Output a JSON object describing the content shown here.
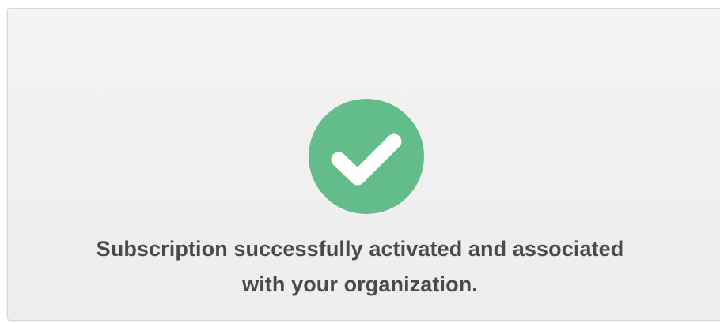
{
  "confirmation": {
    "icon": "check-circle-icon",
    "accent_color": "#63bd8b",
    "message_line1": "Subscription successfully activated and associated",
    "message_line2": "with your organization."
  }
}
